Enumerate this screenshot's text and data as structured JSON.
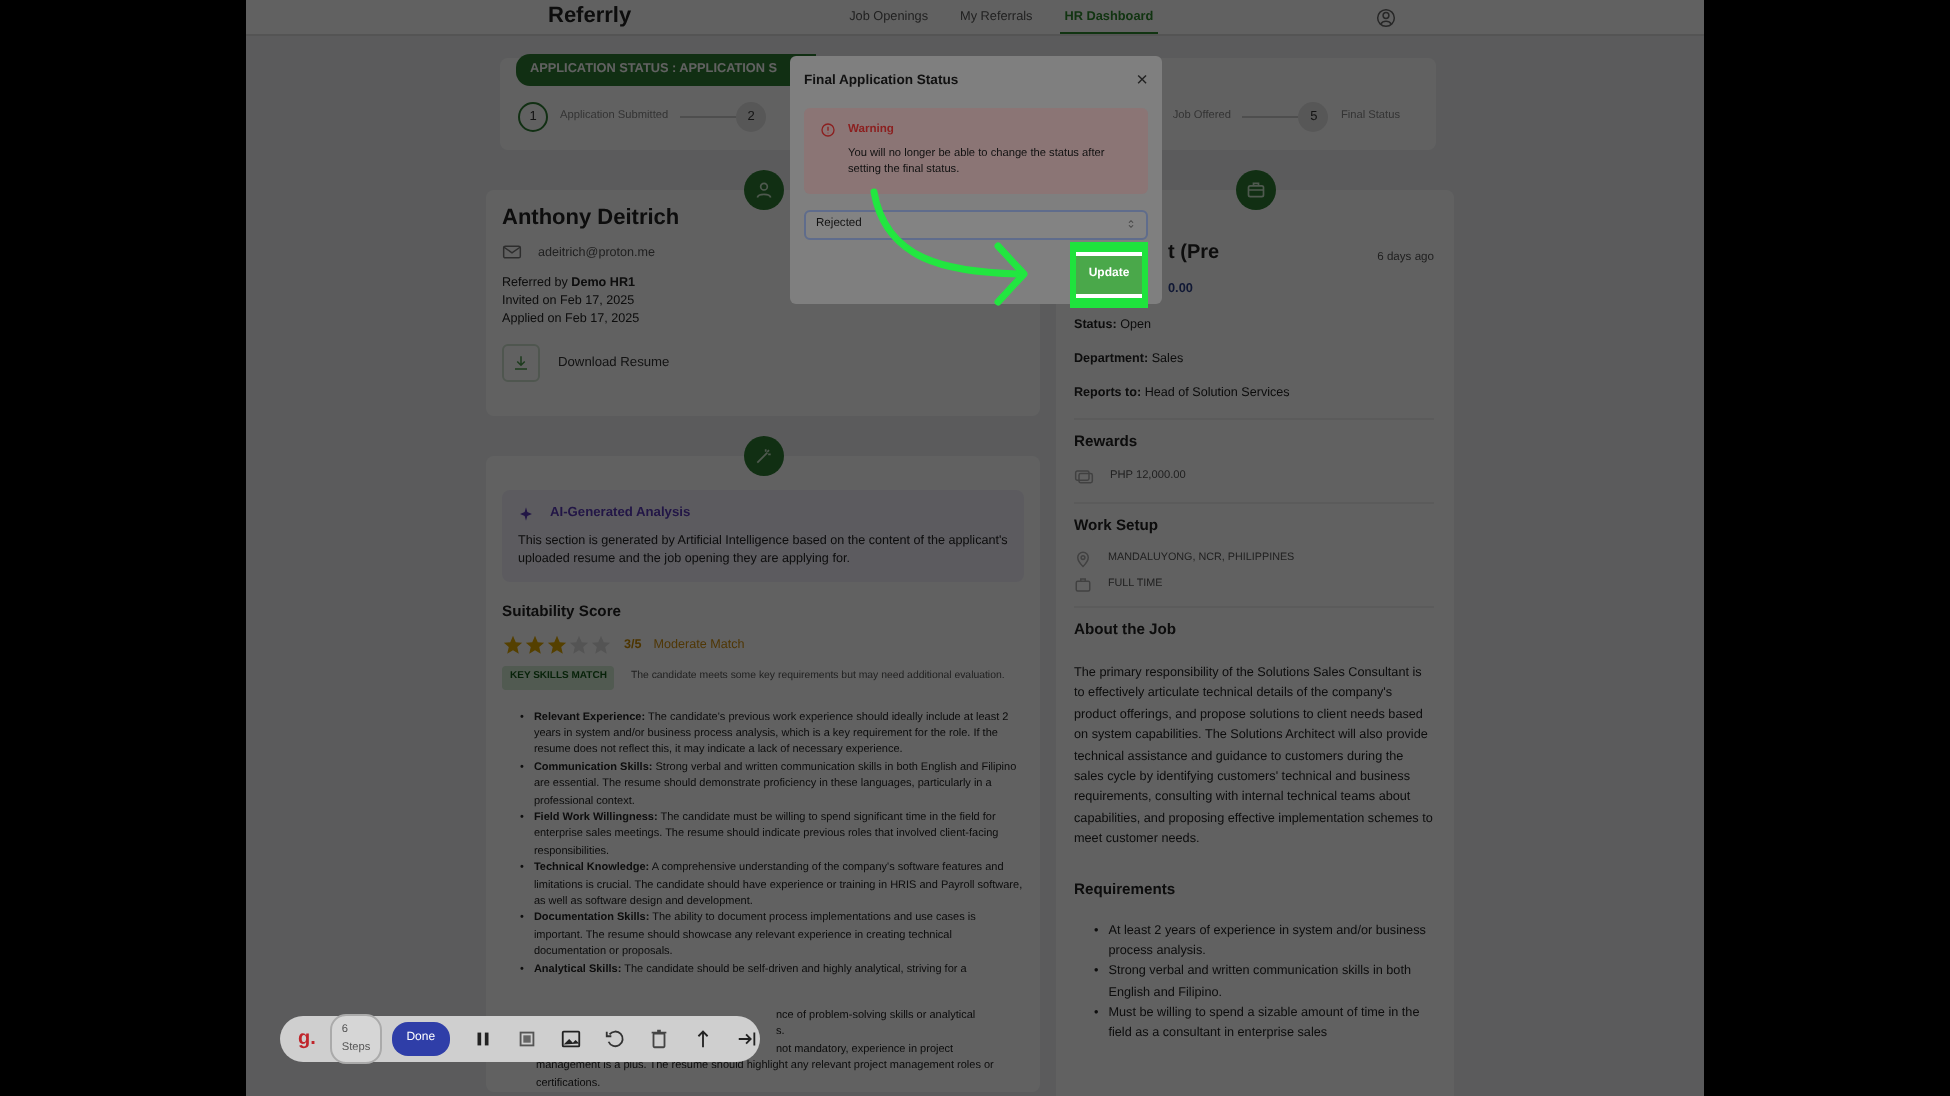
{
  "nav": {
    "brand": "Referrly",
    "links": [
      {
        "label": "Job Openings",
        "selected": false
      },
      {
        "label": "My Referrals",
        "selected": false
      },
      {
        "label": "HR Dashboard",
        "selected": true
      }
    ]
  },
  "status_badge": "APPLICATION STATUS : APPLICATION S",
  "steps": [
    {
      "number": "1",
      "label": "Application Submitted",
      "active": true
    },
    {
      "number": "2",
      "active": false
    },
    {
      "label": "Job Offered",
      "active": false
    },
    {
      "number": "5",
      "label": "Final Status",
      "active": false
    }
  ],
  "candidate": {
    "name": "Anthony Deitrich",
    "email": "adeitrich@proton.me",
    "referred_by": "Referred by **Demo HR1**",
    "invited": "Invited on Feb 17, 2025",
    "applied": "Applied on Feb 17, 2025",
    "download": "Download Resume"
  },
  "analysis": {
    "title": "AI-Generated Analysis",
    "description": "This section is generated by Artificial Intelligence based on the content of the applicant's uploaded resume and the job opening they are applying for.",
    "score_title": "Suitability Score",
    "stars": 3,
    "score": "3/5",
    "match": "Moderate Match",
    "badge": "KEY SKILLS MATCH",
    "badge_note": "The candidate meets some key requirements but may need additional evaluation.",
    "points": [
      "**Relevant Experience:** The candidate's previous work experience should ideally include at least 2 years in system and/or business process analysis, which is a key requirement for the role. If the resume does not reflect this, it may indicate a lack of necessary experience.",
      "**Communication Skills:** Strong verbal and written communication skills in both English and Filipino are essential. The resume should demonstrate proficiency in these languages, particularly in a professional context.",
      "**Field Work Willingness:** The candidate must be willing to spend significant time in the field for enterprise sales meetings. The resume should indicate previous roles that involved client-facing responsibilities.",
      "**Technical Knowledge:** A comprehensive understanding of the company's software features and limitations is crucial. The candidate should have experience or training in HRIS and Payroll software, as well as software design and development.",
      "**Documentation Skills:** The ability to document process implementations and use cases is important. The resume should showcase any relevant experience in creating technical documentation or proposals.",
      "**Analytical Skills:** The candidate should be self-driven and highly analytical, striving for a"
    ],
    "bullet": "•",
    "fragments": [
      "nce of problem-solving skills or analytical",
      "s.",
      "not mandatory, experience in project"
    ],
    "tail": "management is a plus. The resume should highlight any relevant project management roles or certifications."
  },
  "job": {
    "title_fragment": "t (Pre",
    "posted": "6 days ago",
    "salary_fragment": "0.00",
    "details": [
      {
        "label": "Status:",
        "value": "Open"
      },
      {
        "label": "Department:",
        "value": "Sales"
      },
      {
        "label": "Reports to:",
        "value": "Head of Solution Services"
      }
    ],
    "rewards_title": "Rewards",
    "reward": "PHP 12,000.00",
    "work_setup_title": "Work Setup",
    "location": "MANDALUYONG, NCR, PHILIPPINES",
    "employment": "FULL TIME",
    "about_title": "About the Job",
    "about": "The primary responsibility of the Solutions Sales Consultant is to effectively articulate technical details of the company's product offerings, and propose solutions to client needs based on system capabilities. The Solutions Architect will also provide technical assistance and guidance to customers during the sales cycle by identifying customers' technical and business requirements, consulting with internal technical teams about capabilities, and proposing effective implementation schemes to meet customer needs.",
    "requirements_title": "Requirements",
    "bullet": "•",
    "requirements": [
      "At least 2 years of experience in system and/or business process analysis.",
      "Strong verbal and written communication skills in both English and Filipino.",
      "Must be willing to spend a sizable amount of time in the field as a consultant in enterprise sales"
    ]
  },
  "modal": {
    "title": "Final Application Status",
    "close": "×",
    "warning_title": "Warning",
    "warning_text": "You will no longer be able to change the status after setting the final status.",
    "select_value": "Rejected",
    "update": "Update"
  },
  "toolbar": {
    "logo": "g.",
    "steps": "6 Steps",
    "done": "Done"
  }
}
